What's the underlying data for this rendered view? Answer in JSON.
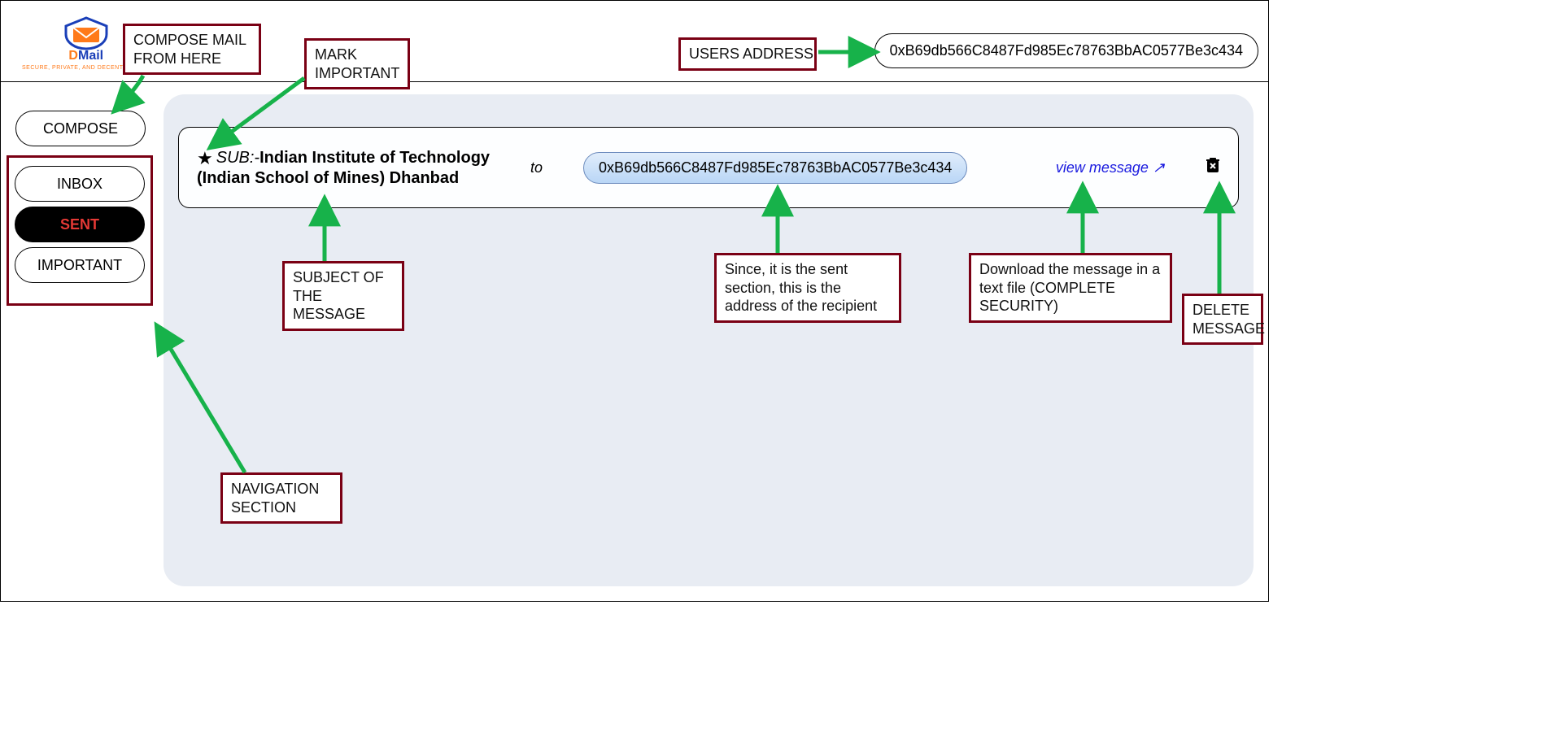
{
  "logo": {
    "name": "DMail",
    "tagline": "SECURE, PRIVATE, AND DECENTRALIZED"
  },
  "header": {
    "user_address": "0xB69db566C8487Fd985Ec78763BbAC0577Be3c434"
  },
  "nav": {
    "compose": "COMPOSE",
    "inbox": "INBOX",
    "sent": "SENT",
    "important": "IMPORTANT"
  },
  "message": {
    "sub_prefix": "SUB:-",
    "subject_line1": "Indian Institute of Technology",
    "subject_line2": "(Indian School of Mines) Dhanbad",
    "to_label": "to",
    "recipient": "0xB69db566C8487Fd985Ec78763BbAC0577Be3c434",
    "view_label": "view message ↗",
    "delete_glyph": "🗑✖"
  },
  "annotations": {
    "compose_note": "COMPOSE MAIL\nFROM HERE",
    "mark_important": "MARK\nIMPORTANT",
    "users_address": "USERS ADDRESS",
    "subject_note": "SUBJECT OF\nTHE MESSAGE",
    "recipient_note": "Since, it is the sent section, this is the address of the recipient",
    "download_note": "Download the message in a text file (COMPLETE SECURITY)",
    "delete_note": "DELETE\nMESSAGE",
    "nav_note": "NAVIGATION\nSECTION"
  }
}
